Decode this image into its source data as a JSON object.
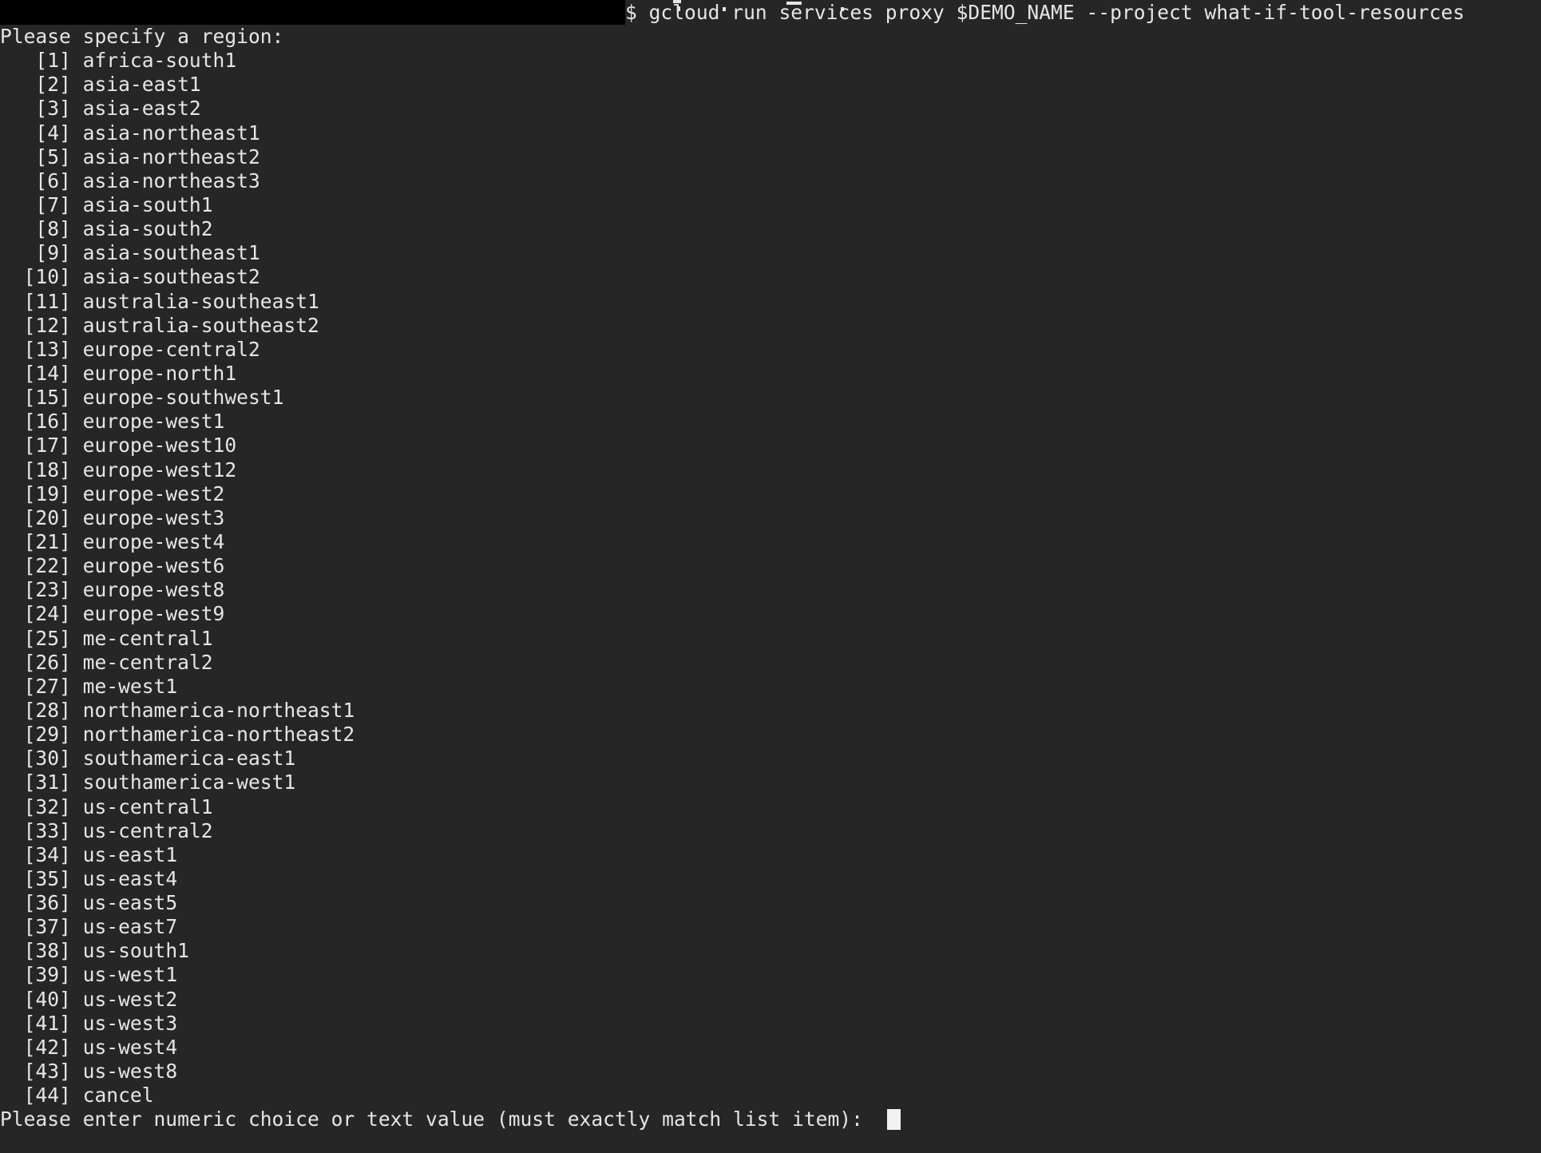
{
  "terminal": {
    "background_color": "#262626",
    "foreground_color": "#e6e6e6",
    "mask_color": "#000000",
    "cursor_color": "#f2f2f2",
    "command_line": "$ gcloud run services proxy $DEMO_NAME --project what-if-tool-resources",
    "prompt_header": "Please specify a region:",
    "final_prompt": "Please enter numeric choice or text value (must exactly match list item): ",
    "cursor": "█",
    "options": [
      {
        "index": "[1]",
        "value": "africa-south1"
      },
      {
        "index": "[2]",
        "value": "asia-east1"
      },
      {
        "index": "[3]",
        "value": "asia-east2"
      },
      {
        "index": "[4]",
        "value": "asia-northeast1"
      },
      {
        "index": "[5]",
        "value": "asia-northeast2"
      },
      {
        "index": "[6]",
        "value": "asia-northeast3"
      },
      {
        "index": "[7]",
        "value": "asia-south1"
      },
      {
        "index": "[8]",
        "value": "asia-south2"
      },
      {
        "index": "[9]",
        "value": "asia-southeast1"
      },
      {
        "index": "[10]",
        "value": "asia-southeast2"
      },
      {
        "index": "[11]",
        "value": "australia-southeast1"
      },
      {
        "index": "[12]",
        "value": "australia-southeast2"
      },
      {
        "index": "[13]",
        "value": "europe-central2"
      },
      {
        "index": "[14]",
        "value": "europe-north1"
      },
      {
        "index": "[15]",
        "value": "europe-southwest1"
      },
      {
        "index": "[16]",
        "value": "europe-west1"
      },
      {
        "index": "[17]",
        "value": "europe-west10"
      },
      {
        "index": "[18]",
        "value": "europe-west12"
      },
      {
        "index": "[19]",
        "value": "europe-west2"
      },
      {
        "index": "[20]",
        "value": "europe-west3"
      },
      {
        "index": "[21]",
        "value": "europe-west4"
      },
      {
        "index": "[22]",
        "value": "europe-west6"
      },
      {
        "index": "[23]",
        "value": "europe-west8"
      },
      {
        "index": "[24]",
        "value": "europe-west9"
      },
      {
        "index": "[25]",
        "value": "me-central1"
      },
      {
        "index": "[26]",
        "value": "me-central2"
      },
      {
        "index": "[27]",
        "value": "me-west1"
      },
      {
        "index": "[28]",
        "value": "northamerica-northeast1"
      },
      {
        "index": "[29]",
        "value": "northamerica-northeast2"
      },
      {
        "index": "[30]",
        "value": "southamerica-east1"
      },
      {
        "index": "[31]",
        "value": "southamerica-west1"
      },
      {
        "index": "[32]",
        "value": "us-central1"
      },
      {
        "index": "[33]",
        "value": "us-central2"
      },
      {
        "index": "[34]",
        "value": "us-east1"
      },
      {
        "index": "[35]",
        "value": "us-east4"
      },
      {
        "index": "[36]",
        "value": "us-east5"
      },
      {
        "index": "[37]",
        "value": "us-east7"
      },
      {
        "index": "[38]",
        "value": "us-south1"
      },
      {
        "index": "[39]",
        "value": "us-west1"
      },
      {
        "index": "[40]",
        "value": "us-west2"
      },
      {
        "index": "[41]",
        "value": "us-west3"
      },
      {
        "index": "[42]",
        "value": "us-west4"
      },
      {
        "index": "[43]",
        "value": "us-west8"
      },
      {
        "index": "[44]",
        "value": "cancel"
      }
    ]
  }
}
